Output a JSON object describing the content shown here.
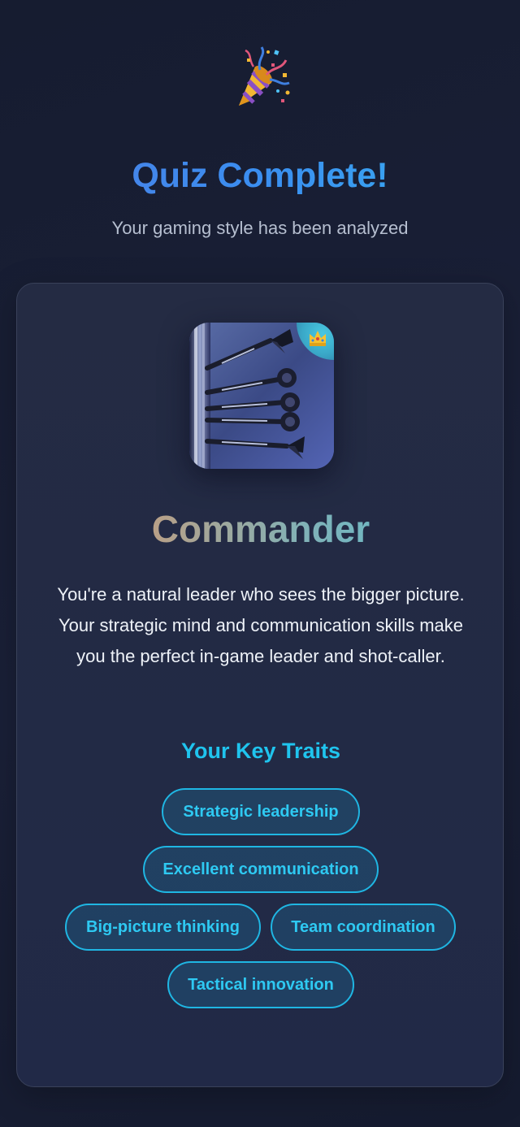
{
  "header": {
    "icon": "party-popper-icon",
    "title": "Quiz Complete!",
    "subtitle": "Your gaming style has been analyzed"
  },
  "result": {
    "image": "darts-image",
    "badge_icon": "crown-icon",
    "role": "Commander",
    "description": "You're a natural leader who sees the bigger picture. Your strategic mind and communication skills make you the perfect in-game leader and shot-caller.",
    "traits_title": "Your Key Traits",
    "traits": [
      "Strategic leadership",
      "Excellent communication",
      "Big-picture thinking",
      "Team coordination",
      "Tactical innovation"
    ]
  },
  "colors": {
    "background": "#161c30",
    "card": "#242b43",
    "accent_cyan": "#1fc4ee",
    "title_blue": "#3a8ef0"
  }
}
